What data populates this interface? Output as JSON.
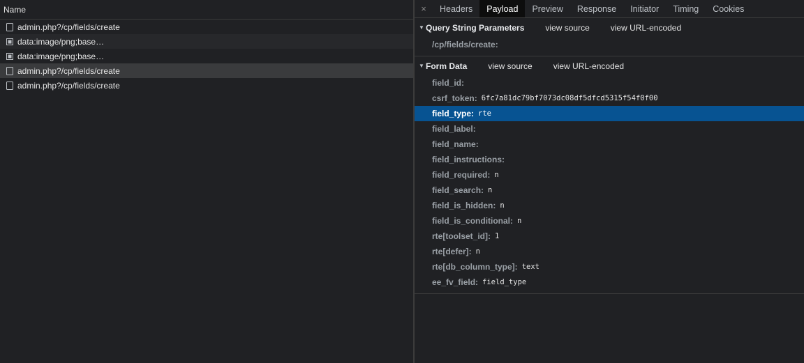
{
  "request_list": {
    "header": "Name",
    "rows": [
      {
        "label": "admin.php?/cp/fields/create",
        "icon": "document-icon"
      },
      {
        "label": "data:image/png;base…",
        "icon": "image-icon"
      },
      {
        "label": "data:image/png;base…",
        "icon": "image-icon"
      },
      {
        "label": "admin.php?/cp/fields/create",
        "icon": "document-icon",
        "selected": true
      },
      {
        "label": "admin.php?/cp/fields/create",
        "icon": "document-icon"
      }
    ]
  },
  "details": {
    "close_glyph": "×",
    "tabs": [
      "Headers",
      "Payload",
      "Preview",
      "Response",
      "Initiator",
      "Timing",
      "Cookies"
    ],
    "active_tab": "Payload",
    "query_section": {
      "title": "Query String Parameters",
      "view_source": "view source",
      "view_url_encoded": "view URL-encoded",
      "items": [
        {
          "key": "/cp/fields/create:",
          "value": ""
        }
      ]
    },
    "form_section": {
      "title": "Form Data",
      "view_source": "view source",
      "view_url_encoded": "view URL-encoded",
      "items": [
        {
          "key": "field_id:",
          "value": ""
        },
        {
          "key": "csrf_token:",
          "value": "6fc7a81dc79bf7073dc08df5dfcd5315f54f0f00"
        },
        {
          "key": "field_type:",
          "value": "rte",
          "selected": true
        },
        {
          "key": "field_label:",
          "value": ""
        },
        {
          "key": "field_name:",
          "value": ""
        },
        {
          "key": "field_instructions:",
          "value": ""
        },
        {
          "key": "field_required:",
          "value": "n"
        },
        {
          "key": "field_search:",
          "value": "n"
        },
        {
          "key": "field_is_hidden:",
          "value": "n"
        },
        {
          "key": "field_is_conditional:",
          "value": "n"
        },
        {
          "key": "rte[toolset_id]:",
          "value": "1"
        },
        {
          "key": "rte[defer]:",
          "value": "n"
        },
        {
          "key": "rte[db_column_type]:",
          "value": "text"
        },
        {
          "key": "ee_fv_field:",
          "value": "field_type"
        }
      ]
    }
  },
  "colors": {
    "background": "#202124",
    "selected_row": "#3a3b3d",
    "selected_param": "#075392",
    "active_tab": "#0d0d0d"
  }
}
